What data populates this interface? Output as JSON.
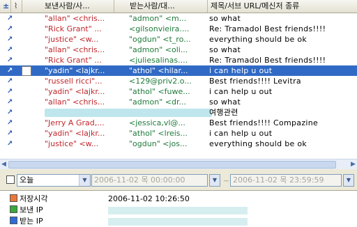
{
  "header": {
    "columns": [
      "",
      "",
      "보낸사람/사...",
      "받는사람/대...",
      "제목/서브 URL/메신저 종류"
    ]
  },
  "rows": [
    {
      "from": "\"allan\" <chris...",
      "to": "\"admon\" <m...",
      "subject": "so what"
    },
    {
      "from": "\"Rick Grant\" ...",
      "to": "<gilsonvieira....",
      "subject": "Re: Tramadol  Best friends!!!!"
    },
    {
      "from": "\"justice\" <w...",
      "to": "\"ogdun\" <t_ro...",
      "subject": "everything should be ok"
    },
    {
      "from": "\"allan\" <chris...",
      "to": "\"admon\" <oli...",
      "subject": "so what"
    },
    {
      "from": "\"Rick Grant\" ...",
      "to": "<juliesalinas....",
      "subject": "Re: Tramadol  Best friends!!!!"
    },
    {
      "from": "\"yadin\" <lajkr...",
      "to": "\"athol\" <hilar...",
      "subject": "i can help u out",
      "selected": true
    },
    {
      "from": "\"russell ricci\"...",
      "to": "<129@priv2.o...",
      "subject": "Best friends!!!!  Levitra"
    },
    {
      "from": "\"yadin\" <lajkr...",
      "to": "\"athol\" <fuwe...",
      "subject": "i can help u out"
    },
    {
      "from": "\"allan\" <chris...",
      "to": "\"admon\" <dr...",
      "subject": "so what"
    },
    {
      "from": "",
      "to": "",
      "subject": "여행관련",
      "redacted": true
    },
    {
      "from": "\"Jerry A Grad,...",
      "to": "<jessica,vl@...",
      "subject": "Best friends!!!!  Compazine"
    },
    {
      "from": "\"yadin\" <lajkr...",
      "to": "\"athol\" <lreis...",
      "subject": "i can help u out"
    },
    {
      "from": "\"justice\" <w...",
      "to": "\"ogdun\" <jos...",
      "subject": "everything should be ok"
    }
  ],
  "filter": {
    "range_value": "오늘",
    "start_datetime": "2006-11-02 목 00:00:00",
    "end_datetime": "2006-11-02 목 23:59:59"
  },
  "detail": {
    "saved_time_label": "저장시각",
    "saved_time_value": "2006-11-02 10:26:50",
    "sender_ip_label": "보낸 IP",
    "receiver_ip_label": "받는 IP"
  },
  "colors": {
    "sender": "#c0262b",
    "receiver": "#1f7a3a",
    "selection": "#316ac5",
    "saved_time_square": "#e8793b",
    "sender_ip_square": "#3aa83a",
    "receiver_ip_square": "#2f6bd6"
  },
  "icons": {
    "row_icon": "arrow-up-right-icon",
    "header_priority": "plus-minus-icon",
    "header_attach": "paperclip-icon"
  }
}
